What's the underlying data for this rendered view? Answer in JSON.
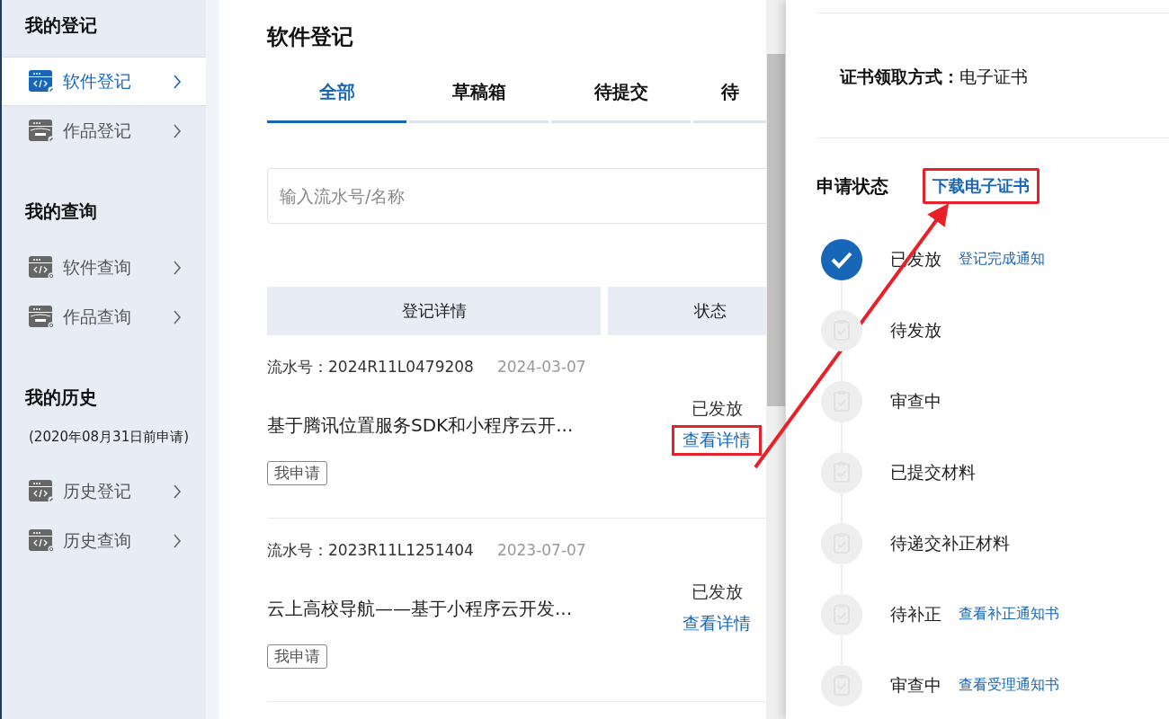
{
  "sidebar": {
    "sections": [
      {
        "title": "我的登记",
        "items": [
          {
            "label": "软件登记",
            "kind": "register",
            "selected": true
          },
          {
            "label": "作品登记",
            "kind": "workregister",
            "selected": false
          }
        ]
      },
      {
        "title": "我的查询",
        "items": [
          {
            "label": "软件查询",
            "kind": "query",
            "selected": false
          },
          {
            "label": "作品查询",
            "kind": "workquery",
            "selected": false
          }
        ]
      },
      {
        "title": "我的历史",
        "note": "(2020年08月31日前申请)",
        "items": [
          {
            "label": "历史登记",
            "kind": "register",
            "selected": false
          },
          {
            "label": "历史查询",
            "kind": "query",
            "selected": false
          }
        ]
      }
    ]
  },
  "main": {
    "title": "软件登记",
    "tabs": [
      {
        "label": "全部",
        "selected": true
      },
      {
        "label": "草稿箱",
        "selected": false
      },
      {
        "label": "待提交",
        "selected": false
      },
      {
        "label": "待",
        "selected": false
      }
    ],
    "search": {
      "placeholder": "输入流水号/名称"
    },
    "table": {
      "columns": [
        "登记详情",
        "状态"
      ],
      "records": [
        {
          "serial": "流水号：2024R11L0479208",
          "date": "2024-03-07",
          "name": "基于腾讯位置服务SDK和小程序云开...",
          "tag": "我申请",
          "status": "已发放",
          "action": "查看详情",
          "highlighted": true
        },
        {
          "serial": "流水号：2023R11L1251404",
          "date": "2023-07-07",
          "name": "云上高校导航——基于小程序云开发...",
          "tag": "我申请",
          "status": "已发放",
          "action": "查看详情",
          "highlighted": false
        }
      ]
    }
  },
  "detail": {
    "cert_label": "证书领取方式：",
    "cert_value": "电子证书",
    "status_title": "申请状态",
    "download": {
      "label": "下载电子证书",
      "highlighted": true
    },
    "steps": [
      {
        "label": "已发放",
        "done": true,
        "link": "登记完成通知"
      },
      {
        "label": "待发放",
        "done": false
      },
      {
        "label": "审查中",
        "done": false
      },
      {
        "label": "已提交材料",
        "done": false
      },
      {
        "label": "待递交补正材料",
        "done": false
      },
      {
        "label": "待补正",
        "done": false,
        "link": "查看补正通知书"
      },
      {
        "label": "审查中",
        "done": false,
        "link": "查看受理通知书"
      }
    ]
  }
}
